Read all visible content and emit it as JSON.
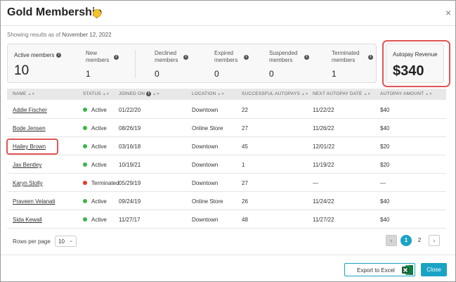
{
  "window": {
    "title": "Gold Membership",
    "close_glyph": "×"
  },
  "as_of": {
    "prefix": "Showing results as of ",
    "date": "November 12, 2022"
  },
  "stats": {
    "active": {
      "label": "Active members",
      "value": "10"
    },
    "new": {
      "label_line1": "New",
      "label_line2": "members",
      "value": "1"
    },
    "declined": {
      "label_line1": "Declined",
      "label_line2": "members",
      "value": "0"
    },
    "expired": {
      "label_line1": "Expired",
      "label_line2": "members",
      "value": "0"
    },
    "suspended": {
      "label_line1": "Suspended",
      "label_line2": "members",
      "value": "0"
    },
    "terminated": {
      "label_line1": "Terminated",
      "label_line2": "members",
      "value": "1"
    }
  },
  "revenue": {
    "label": "Autopay Revenue",
    "value": "$340"
  },
  "table": {
    "headers": [
      "NAME",
      "STATUS",
      "JOINED ON",
      "LOCATION",
      "SUCCESSFUL AUTOPAYS",
      "NEXT AUTOPAY DATE",
      "AUTOPAY AMOUNT"
    ],
    "rows": [
      {
        "name": "Addie Fischer",
        "status": "Active",
        "joined": "01/22/20",
        "location": "Downtown",
        "autopays": "22",
        "next": "11/22/22",
        "amount": "$40"
      },
      {
        "name": "Bode Jensen",
        "status": "Active",
        "joined": "08/26/19",
        "location": "Online Store",
        "autopays": "27",
        "next": "11/26/22",
        "amount": "$40"
      },
      {
        "name": "Hailey Brown",
        "status": "Active",
        "joined": "03/16/18",
        "location": "Downtown",
        "autopays": "45",
        "next": "12/01/22",
        "amount": "$20"
      },
      {
        "name": "Jax Bentley",
        "status": "Active",
        "joined": "10/19/21",
        "location": "Downtown",
        "autopays": "1",
        "next": "11/19/22",
        "amount": "$20"
      },
      {
        "name": "Karyn Stolly",
        "status": "Terminated",
        "joined": "05/29/19",
        "location": "Downtown",
        "autopays": "27",
        "next": "—",
        "amount": "—"
      },
      {
        "name": "Praveen Velanati",
        "status": "Active",
        "joined": "09/24/19",
        "location": "Online Store",
        "autopays": "26",
        "next": "11/24/22",
        "amount": "$40"
      },
      {
        "name": "Sida Kewall",
        "status": "Active",
        "joined": "11/27/17",
        "location": "Downtown",
        "autopays": "48",
        "next": "11/27/22",
        "amount": "$40"
      }
    ]
  },
  "colors": {
    "active": "#3cb54a",
    "terminated": "#e23b2e",
    "accent": "#1aa3c4",
    "highlight": "#e05555"
  },
  "pagination": {
    "rows_label": "Rows per page",
    "rows_value": "10",
    "pages": [
      "1",
      "2"
    ],
    "prev_glyph": "‹",
    "next_glyph": "›"
  },
  "footer": {
    "export_label": "Export to Excel",
    "close_label": "Close"
  }
}
